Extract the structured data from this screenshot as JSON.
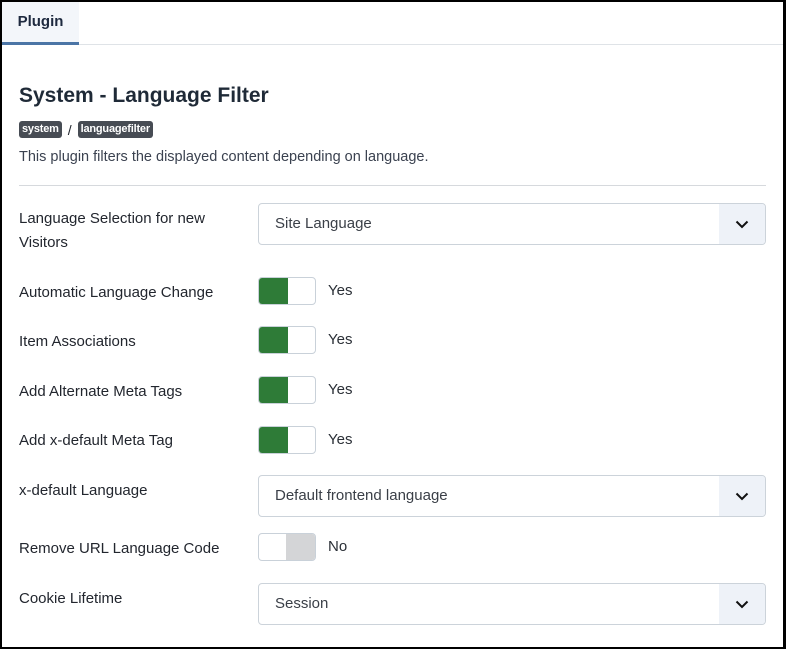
{
  "tabs": [
    {
      "label": "Plugin",
      "active": true
    }
  ],
  "header": {
    "title": "System - Language Filter",
    "breadcrumb": [
      "system",
      "languagefilter"
    ],
    "breadcrumb_separator": "/",
    "description": "This plugin filters the displayed content depending on language."
  },
  "fields": {
    "language_selection": {
      "label_line1": "Language Selection for new",
      "label_line2": "Visitors",
      "value": "Site Language"
    },
    "automatic_language_change": {
      "label": "Automatic Language Change",
      "state": "Yes",
      "on": true
    },
    "item_associations": {
      "label": "Item Associations",
      "state": "Yes",
      "on": true
    },
    "alternate_meta_tags": {
      "label": "Add Alternate Meta Tags",
      "state": "Yes",
      "on": true
    },
    "xdefault_meta_tag": {
      "label": "Add x-default Meta Tag",
      "state": "Yes",
      "on": true
    },
    "xdefault_language": {
      "label": "x-default Language",
      "value": "Default frontend language"
    },
    "remove_url_code": {
      "label": "Remove URL Language Code",
      "state": "No",
      "on": false
    },
    "cookie_lifetime": {
      "label": "Cookie Lifetime",
      "value": "Session"
    }
  },
  "icons": {
    "select_caret": "chevron-down-icon"
  },
  "colors": {
    "toggle_on": "#2e7b37",
    "toggle_off": "#d4d5d7",
    "tab_accent": "#4b75a6",
    "badge_bg": "#474c54"
  }
}
